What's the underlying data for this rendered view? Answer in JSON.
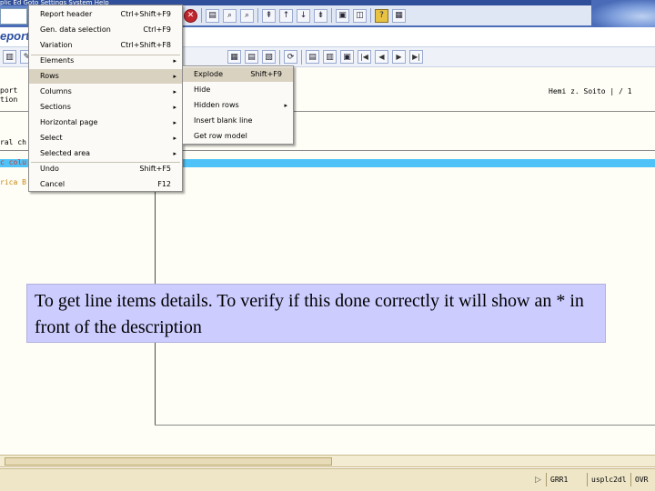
{
  "window": {
    "title_fragment": "plic  Ed  Goto  Settings  System  Help",
    "page_title": "eport"
  },
  "toolbar_icons": [
    "red-cancel",
    "print",
    "find",
    "find-next",
    "first-page",
    "prev-page",
    "next-page",
    "last-page",
    "create-session",
    "shortcut",
    "help",
    "customize"
  ],
  "app_toolbar_icons": [
    "layout",
    "attribute",
    "arrow",
    "save",
    "graph",
    "select",
    "overview",
    "first",
    "prev",
    "next",
    "last"
  ],
  "report_header_left": [
    "port",
    "tion",
    "ral ch"
  ],
  "author_line": "Hemi z. Soito  |  / 1",
  "column_fragment": "c colu",
  "orange_fragment": "rica B",
  "edit_menu": {
    "items": [
      {
        "label": "Report header",
        "accel": "Ctrl+Shift+F9",
        "submenu": false
      },
      {
        "label": "Gen. data selection",
        "accel": "Ctrl+F9",
        "submenu": false
      },
      {
        "label": "Variation",
        "accel": "Ctrl+Shift+F8",
        "submenu": false
      },
      {
        "label": "Elements",
        "accel": "",
        "submenu": true
      },
      {
        "label": "Rows",
        "accel": "",
        "submenu": true
      },
      {
        "label": "Columns",
        "accel": "",
        "submenu": true
      },
      {
        "label": "Sections",
        "accel": "",
        "submenu": true
      },
      {
        "label": "Horizontal page",
        "accel": "",
        "submenu": true
      },
      {
        "label": "Select",
        "accel": "",
        "submenu": true
      },
      {
        "label": "Selected area",
        "accel": "",
        "submenu": true
      },
      {
        "label": "Undo",
        "accel": "Shift+F5",
        "submenu": false
      },
      {
        "label": "Cancel",
        "accel": "F12",
        "submenu": false
      }
    ],
    "highlighted_index": 4
  },
  "rows_submenu": {
    "items": [
      {
        "label": "Explode",
        "accel": "Shift+F9",
        "submenu": false
      },
      {
        "label": "Hide",
        "accel": "",
        "submenu": false
      },
      {
        "label": "Hidden rows",
        "accel": "",
        "submenu": true
      },
      {
        "label": "Insert blank line",
        "accel": "",
        "submenu": false
      },
      {
        "label": "Get row model",
        "accel": "",
        "submenu": false
      }
    ],
    "highlighted_index": 0
  },
  "note": "To get line items details. To verify if this done correctly it will show an * in front of the description",
  "status_bar": {
    "system": "GRR1",
    "server": "usplc2dl",
    "mode": "OVR"
  }
}
